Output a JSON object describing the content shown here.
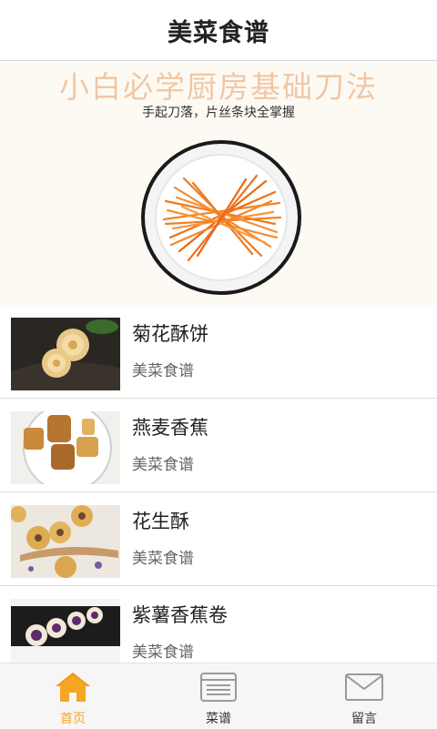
{
  "header": {
    "title": "美菜食谱"
  },
  "banner": {
    "title": "小白必学厨房基础刀法",
    "subtitle": "手起刀落，片丝条块全掌握"
  },
  "list": [
    {
      "title": "菊花酥饼",
      "subtitle": "美菜食谱",
      "thumb_icon": "chrysanthemum-pastry-photo"
    },
    {
      "title": "燕麦香蕉",
      "subtitle": "美菜食谱",
      "thumb_icon": "oat-banana-photo"
    },
    {
      "title": "花生酥",
      "subtitle": "美菜食谱",
      "thumb_icon": "peanut-pastry-photo"
    },
    {
      "title": "紫薯香蕉卷",
      "subtitle": "美菜食谱",
      "thumb_icon": "purple-potato-banana-roll-photo"
    }
  ],
  "tabbar": {
    "tabs": [
      {
        "label": "首页",
        "icon": "home-icon",
        "active": true
      },
      {
        "label": "菜谱",
        "icon": "recipe-icon",
        "active": false
      },
      {
        "label": "留言",
        "icon": "mail-icon",
        "active": false
      }
    ],
    "active_color": "#f5a623"
  }
}
